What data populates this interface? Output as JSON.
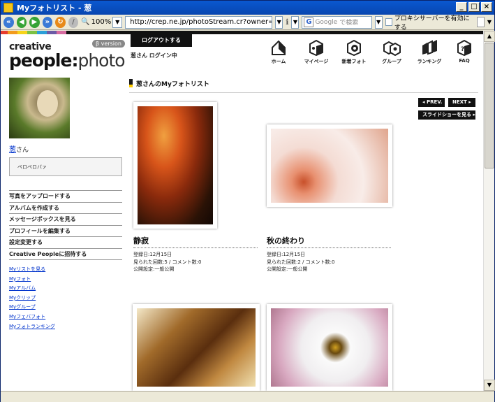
{
  "window": {
    "title": "Myフォトリスト - 葱"
  },
  "browser": {
    "zoom": "100%",
    "url": "http://crep.ne.jp/photoStream.cr?owner=3763fdb",
    "search_placeholder": "で検索",
    "search_engine": "Google",
    "proxy_label": "プロキシサーバーを有効にする"
  },
  "site": {
    "logo_line1": "creative",
    "logo_people": "people",
    "logo_sep": ":",
    "logo_photo": "photo",
    "beta": "β version",
    "logout_label": "ログアウトする",
    "user_status": "葱さん ログイン中",
    "nav": [
      "ホーム",
      "マイページ",
      "新着フォト",
      "グループ",
      "ランキング",
      "FAQ"
    ],
    "colorbar": [
      "#e63c2e",
      "#f29b1d",
      "#f7d31a",
      "#7cc142",
      "#2a9fd8",
      "#6b5aa6",
      "#d66ba0"
    ]
  },
  "sidebar": {
    "username": "葱",
    "name_suffix": "さん",
    "comment": "ペロペロバァ",
    "menu": [
      "写真をアップロードする",
      "アルバムを作成する",
      "メッセージボックスを見る",
      "プロフィールを編集する",
      "設定変更する",
      "Creative Peopleに招待する"
    ],
    "links": [
      "Myリストを見る",
      "Myフォト",
      "Myアルバム",
      "Myクリップ",
      "Myグループ",
      "Myフェバフォト",
      "Myフォトランキング"
    ]
  },
  "main": {
    "heading": "葱さんのMyフォトリスト",
    "prev_label": "PREV.",
    "next_label": "NEXT",
    "slideshow_label": "スライドショーを見る",
    "photos": [
      {
        "title": "静寂",
        "date": "登録日:12月15日",
        "stats": "見られた回数:5 / コメント数:0",
        "visibility": "公開設定:一般公開"
      },
      {
        "title": "秋の終わり",
        "date": "登録日:12月15日",
        "stats": "見られた回数:2 / コメント数:0",
        "visibility": "公開設定:一般公開"
      }
    ]
  }
}
